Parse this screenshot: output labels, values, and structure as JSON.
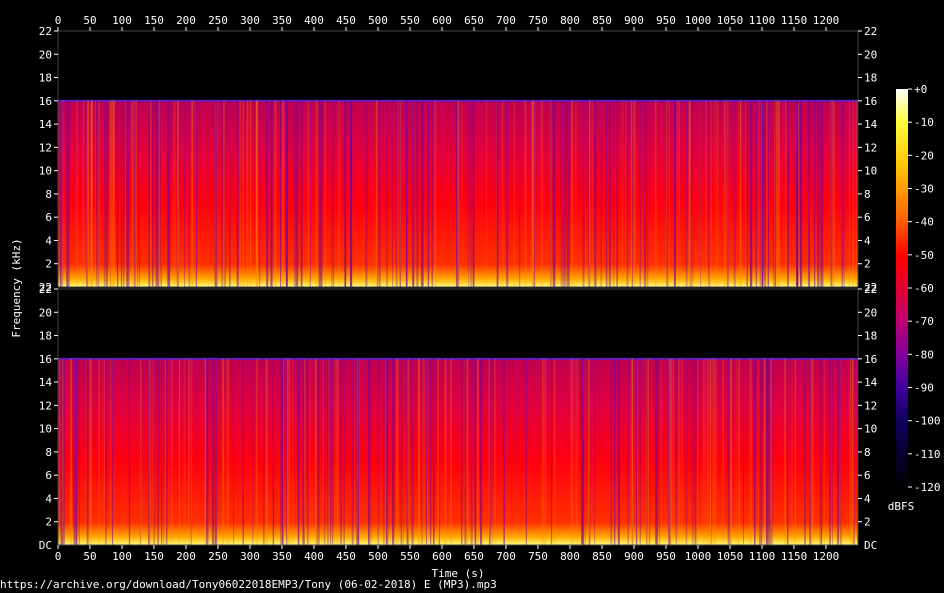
{
  "chart_data": {
    "type": "heatmap",
    "xlabel": "Time (s)",
    "ylabel": "Frequency (kHz)",
    "xlim": [
      0,
      1250
    ],
    "x_ticks": [
      0,
      50,
      100,
      150,
      200,
      250,
      300,
      350,
      400,
      450,
      500,
      550,
      600,
      650,
      700,
      750,
      800,
      850,
      900,
      950,
      1000,
      1050,
      1100,
      1150,
      1200
    ],
    "panels": [
      {
        "channel": "top",
        "ylim": [
          0,
          22
        ],
        "y_tick_labels": [
          "2",
          "4",
          "6",
          "8",
          "10",
          "12",
          "14",
          "16",
          "18",
          "20",
          "22"
        ],
        "bottom_label": "22"
      },
      {
        "channel": "bottom",
        "ylim": [
          0,
          22
        ],
        "y_tick_labels": [
          "2",
          "4",
          "6",
          "8",
          "10",
          "12",
          "14",
          "16",
          "18",
          "20",
          "22"
        ],
        "bottom_label": "DC"
      }
    ],
    "cutoff_khz": 16,
    "colorbar": {
      "unit": "dBFS",
      "range": [
        -120,
        0
      ],
      "tick_labels": [
        "+0",
        "-10",
        "-20",
        "-30",
        "-40",
        "-50",
        "-60",
        "-70",
        "-80",
        "-90",
        "-100",
        "-110",
        "-120"
      ],
      "colors": [
        "#ffffff",
        "#ffff40",
        "#ffc000",
        "#ff6000",
        "#ff0000",
        "#e00030",
        "#c00070",
        "#8000a0",
        "#4000a0",
        "#100060",
        "#000000"
      ]
    },
    "grid": false,
    "legend": "right"
  },
  "source_url": "https://archive.org/download/Tony06022018EMP3/Tony (06-02-2018) E (MP3).mp3"
}
